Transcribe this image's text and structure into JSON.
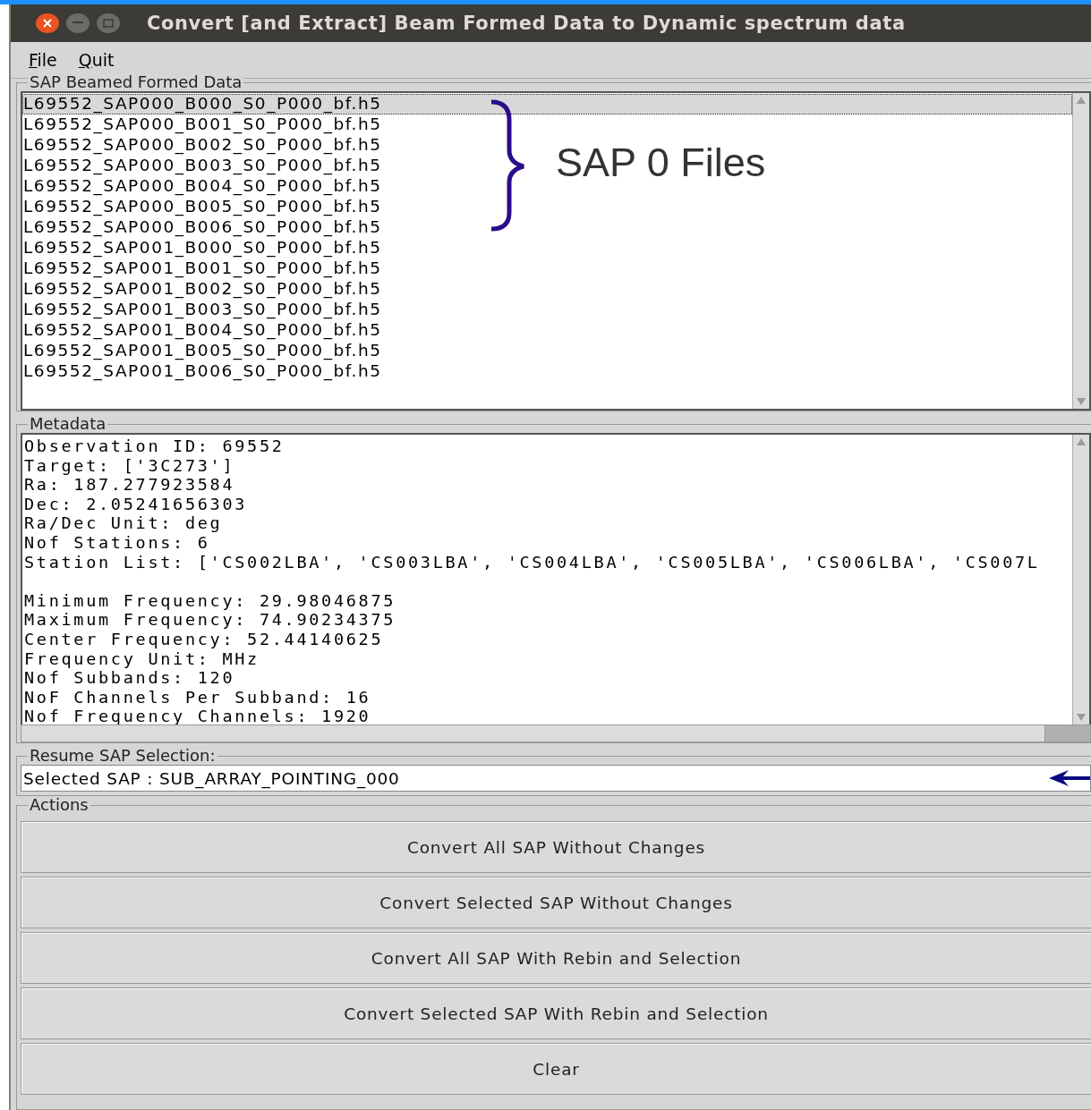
{
  "window": {
    "title": "Convert [and Extract] Beam Formed Data to Dynamic spectrum data"
  },
  "menu": [
    {
      "label": "File"
    },
    {
      "label": "Quit"
    }
  ],
  "sap_list": {
    "title": "SAP Beamed Formed Data",
    "files": [
      {
        "name": "L69552_SAP000_B000_S0_P000_bf.h5",
        "selected": true
      },
      {
        "name": "L69552_SAP000_B001_S0_P000_bf.h5",
        "selected": false
      },
      {
        "name": "L69552_SAP000_B002_S0_P000_bf.h5",
        "selected": false
      },
      {
        "name": "L69552_SAP000_B003_S0_P000_bf.h5",
        "selected": false
      },
      {
        "name": "L69552_SAP000_B004_S0_P000_bf.h5",
        "selected": false
      },
      {
        "name": "L69552_SAP000_B005_S0_P000_bf.h5",
        "selected": false
      },
      {
        "name": "L69552_SAP000_B006_S0_P000_bf.h5",
        "selected": false
      },
      {
        "name": "L69552_SAP001_B000_S0_P000_bf.h5",
        "selected": false
      },
      {
        "name": "L69552_SAP001_B001_S0_P000_bf.h5",
        "selected": false
      },
      {
        "name": "L69552_SAP001_B002_S0_P000_bf.h5",
        "selected": false
      },
      {
        "name": "L69552_SAP001_B003_S0_P000_bf.h5",
        "selected": false
      },
      {
        "name": "L69552_SAP001_B004_S0_P000_bf.h5",
        "selected": false
      },
      {
        "name": "L69552_SAP001_B005_S0_P000_bf.h5",
        "selected": false
      },
      {
        "name": "L69552_SAP001_B006_S0_P000_bf.h5",
        "selected": false
      }
    ],
    "annotation": "SAP 0 Files"
  },
  "metadata": {
    "title": "Metadata",
    "groups": [
      [
        "Observation ID: 69552",
        "Target: ['3C273']",
        "Ra: 187.277923584",
        "Dec: 2.05241656303",
        "Ra/Dec Unit: deg",
        "Nof Stations: 6",
        "Station List: ['CS002LBA', 'CS003LBA', 'CS004LBA', 'CS005LBA', 'CS006LBA', 'CS007L"
      ],
      [
        "Minimum Frequency: 29.98046875",
        "Maximum Frequency: 74.90234375",
        "Center Frequency: 52.44140625",
        "Frequency Unit: MHz",
        "Nof Subbands: 120",
        "NoF Channels Per Subband: 16",
        "Nof Frequency Channels: 1920"
      ]
    ]
  },
  "resume": {
    "title": "Resume SAP Selection:",
    "value": "Selected SAP : SUB_ARRAY_POINTING_000"
  },
  "actions": {
    "title": "Actions",
    "buttons": [
      "Convert All SAP Without Changes",
      "Convert Selected SAP Without Changes",
      "Convert All SAP With Rebin and Selection",
      "Convert Selected SAP With Rebin and Selection",
      "Clear"
    ]
  }
}
